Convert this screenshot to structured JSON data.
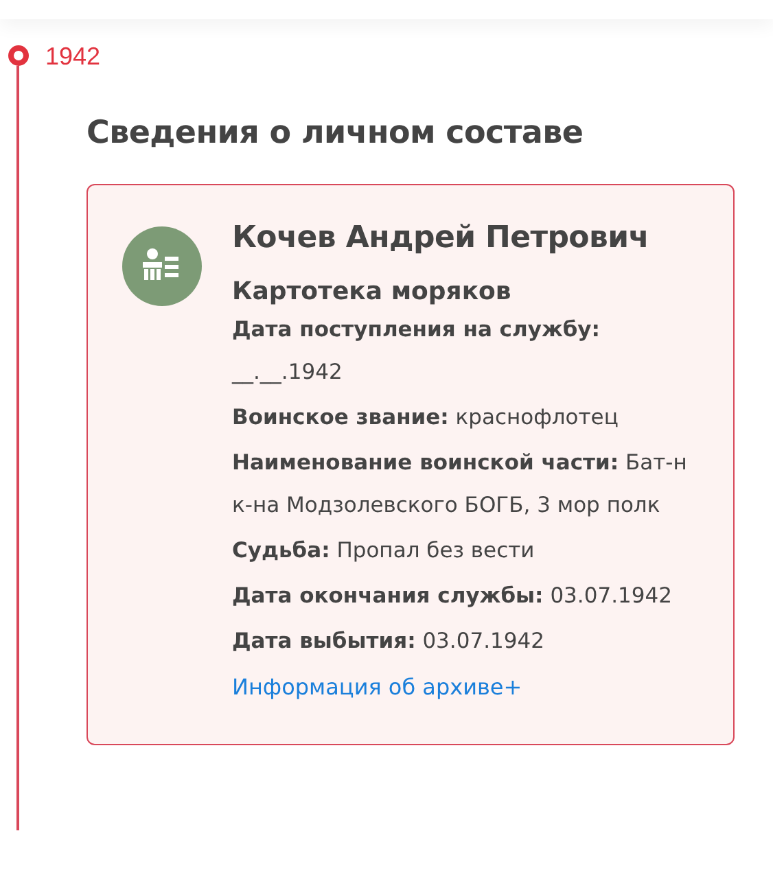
{
  "timeline": {
    "year": "1942"
  },
  "section": {
    "title": "Сведения о личном составе"
  },
  "card": {
    "name": "Кочев Андрей Петрович",
    "source": "Картотека моряков",
    "fields": [
      {
        "text": "**Дата поступления на службу:** __.__.1942"
      },
      {
        "text": "**Воинское звание:** краснофлотец"
      },
      {
        "text": "**Наименование воинской части:** Бат-н к-на Модзолевского БОГБ, 3 мор полк"
      },
      {
        "text": "**Судьба:** Пропал без вести"
      },
      {
        "text": "**Дата окончания службы:** 03.07.1942"
      },
      {
        "text": "**Дата выбытия:** 03.07.1942"
      }
    ],
    "archive_link": "Информация об архиве+"
  }
}
